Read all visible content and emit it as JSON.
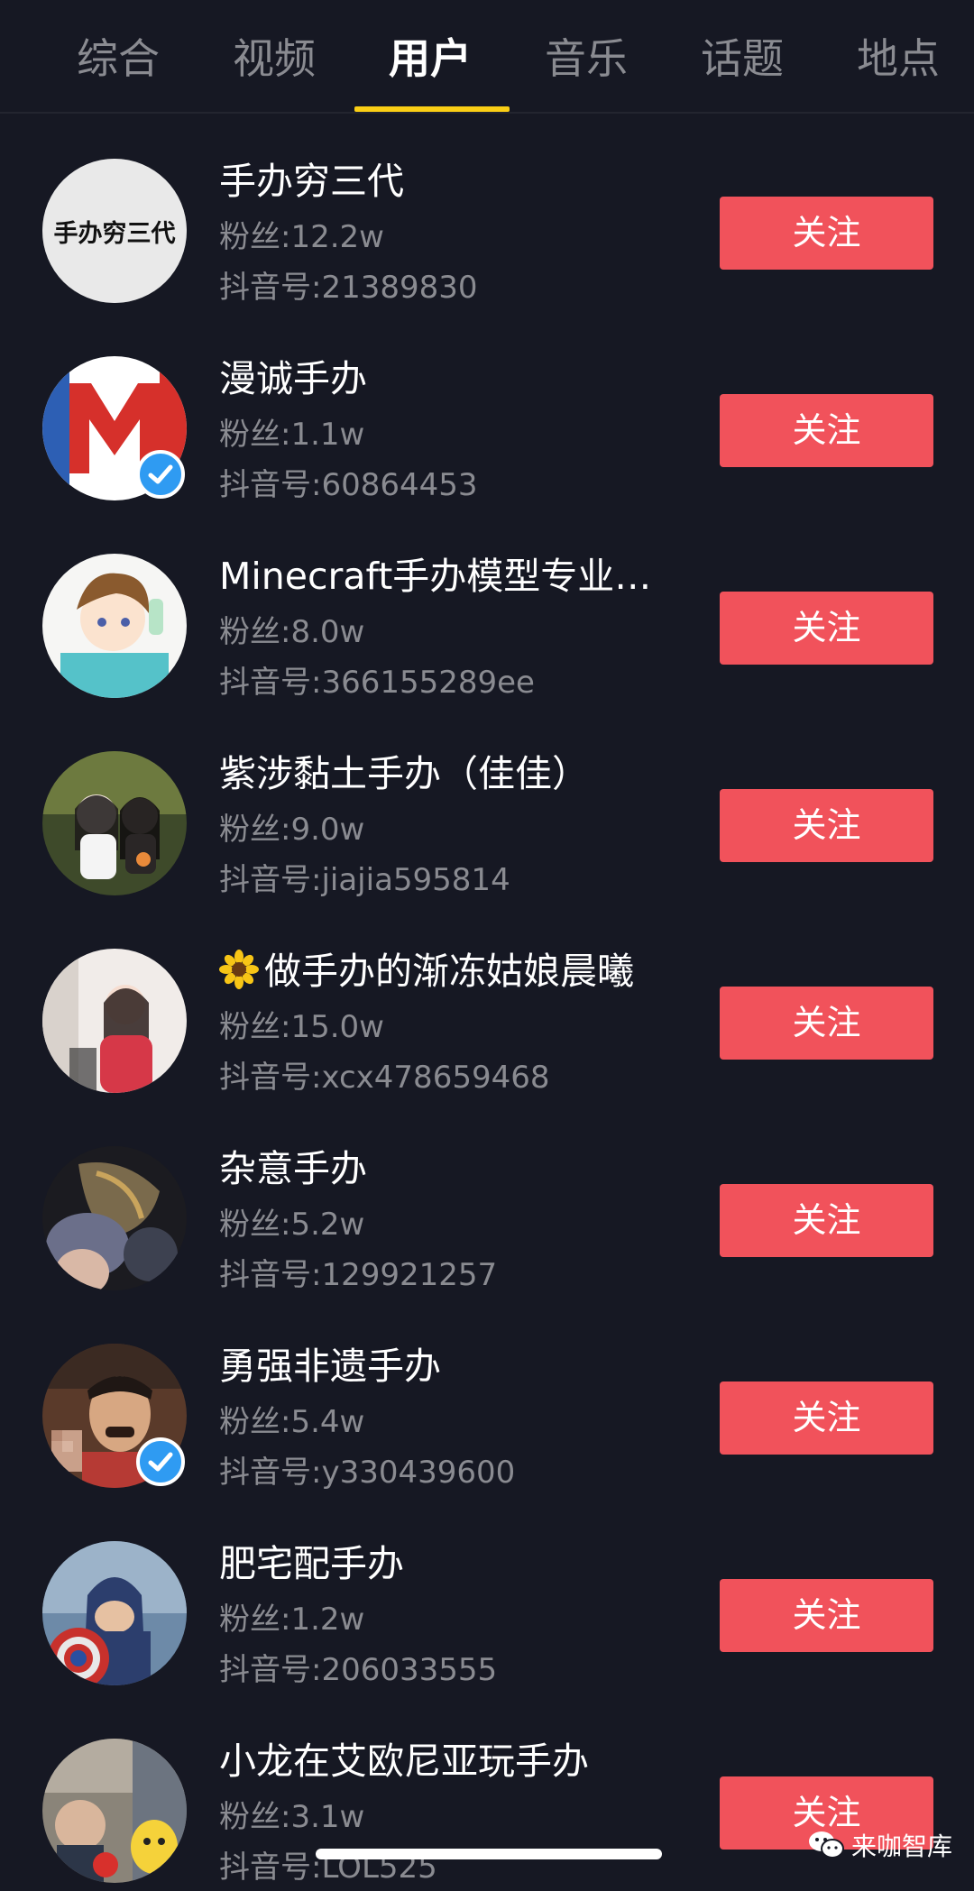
{
  "tabs": [
    {
      "label": "综合"
    },
    {
      "label": "视频"
    },
    {
      "label": "用户"
    },
    {
      "label": "音乐"
    },
    {
      "label": "话题"
    },
    {
      "label": "地点"
    }
  ],
  "active_tab": "用户",
  "colors": {
    "background": "#161823",
    "accent_underline": "#face15",
    "follow_button": "#f1525b",
    "secondary_text": "#8a8b91",
    "verified_badge": "#2f9bf2"
  },
  "users": [
    {
      "name": "手办穷三代",
      "fans": "粉丝:12.2w",
      "id": "抖音号:21389830",
      "verified": false,
      "follow_label": "关注",
      "avatar_text": "手办穷三代"
    },
    {
      "name": "漫诚手办",
      "fans": "粉丝:1.1w",
      "id": "抖音号:60864453",
      "verified": true,
      "follow_label": "关注",
      "avatar_text": "M"
    },
    {
      "name": "Minecraft手办模型专业…",
      "fans": "粉丝:8.0w",
      "id": "抖音号:366155289ee",
      "verified": false,
      "follow_label": "关注"
    },
    {
      "name": "紫涉黏土手办（佳佳）",
      "fans": "粉丝:9.0w",
      "id": "抖音号:jiajia595814",
      "verified": false,
      "follow_label": "关注"
    },
    {
      "name": "做手办的渐冻姑娘晨曦",
      "fans": "粉丝:15.0w",
      "id": "抖音号:xcx478659468",
      "verified": false,
      "follow_label": "关注",
      "name_icon": "sunflower-icon"
    },
    {
      "name": "杂意手办",
      "fans": "粉丝:5.2w",
      "id": "抖音号:129921257",
      "verified": false,
      "follow_label": "关注"
    },
    {
      "name": "勇强非遗手办",
      "fans": "粉丝:5.4w",
      "id": "抖音号:y330439600",
      "verified": true,
      "follow_label": "关注"
    },
    {
      "name": "肥宅配手办",
      "fans": "粉丝:1.2w",
      "id": "抖音号:206033555",
      "verified": false,
      "follow_label": "关注"
    },
    {
      "name": "小龙在艾欧尼亚玩手办",
      "fans": "粉丝:3.1w",
      "id": "抖音号:LOL525",
      "verified": false,
      "follow_label": "关注"
    }
  ],
  "watermark": {
    "text": "来咖智库",
    "icon": "wechat-icon"
  }
}
